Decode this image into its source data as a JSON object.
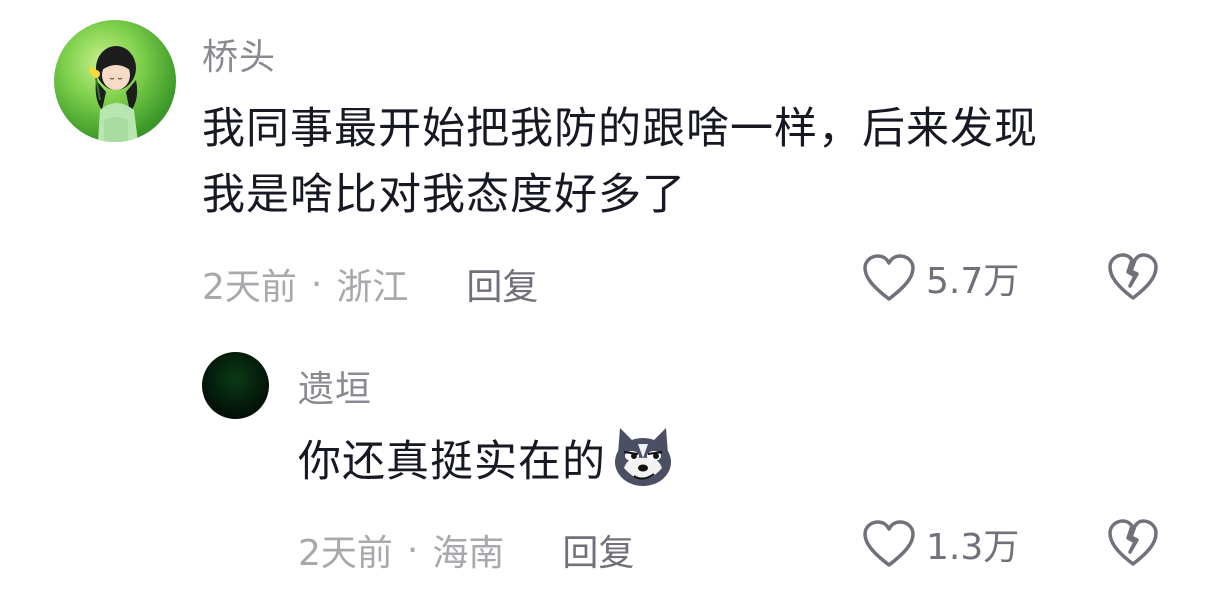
{
  "comments": [
    {
      "username": "桥头",
      "text_line1": "我同事最开始把我防的跟啥一样，后来发现",
      "text_line2": "我是啥比对我态度好多了",
      "time": "2天前",
      "separator": "·",
      "location": "浙江",
      "reply_label": "回复",
      "likes": "5.7万",
      "like_icon": "heart-outline-icon",
      "dislike_icon": "broken-heart-icon"
    }
  ],
  "replies": [
    {
      "username": "遗垣",
      "text": "你还真挺实在的",
      "emoji": "husky-smirk-emoji",
      "time": "2天前",
      "separator": "·",
      "location": "海南",
      "reply_label": "回复",
      "likes": "1.3万",
      "like_icon": "heart-outline-icon",
      "dislike_icon": "broken-heart-icon"
    }
  ],
  "colors": {
    "username": "#8a8b91",
    "text": "#161823",
    "meta": "#a8a9ad",
    "action": "#70717a"
  }
}
